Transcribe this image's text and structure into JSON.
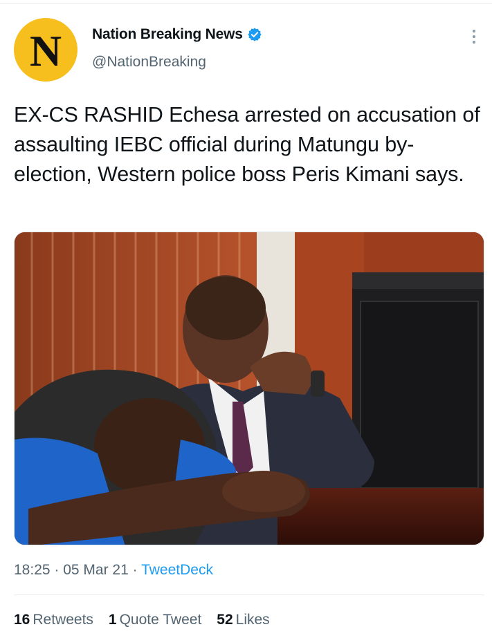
{
  "tweet": {
    "author": {
      "display_name": "Nation Breaking News",
      "handle": "@NationBreaking",
      "avatar_letter": "N",
      "verified": true
    },
    "text": "EX-CS RASHID Echesa arrested on accusation of assaulting IEBC official during Matungu by-election, Western police boss Peris Kimani says.",
    "media": {
      "alt": "Photo of a man in a suit seated in a courtroom with his hand on his chin, another man resting his head on his arms in the foreground"
    },
    "time": "18:25",
    "separator": "·",
    "date": "05 Mar 21",
    "source": "TweetDeck",
    "stats": {
      "retweets_count": "16",
      "retweets_label": "Retweets",
      "quotes_count": "1",
      "quotes_label": "Quote Tweet",
      "likes_count": "52",
      "likes_label": "Likes"
    }
  },
  "colors": {
    "brand_avatar": "#f7bf1e",
    "link": "#1d9bf0",
    "verified": "#1d9bf0",
    "secondary_text": "#536471"
  },
  "icons": {
    "verified": "verified-badge-icon",
    "more": "more-options-icon"
  }
}
